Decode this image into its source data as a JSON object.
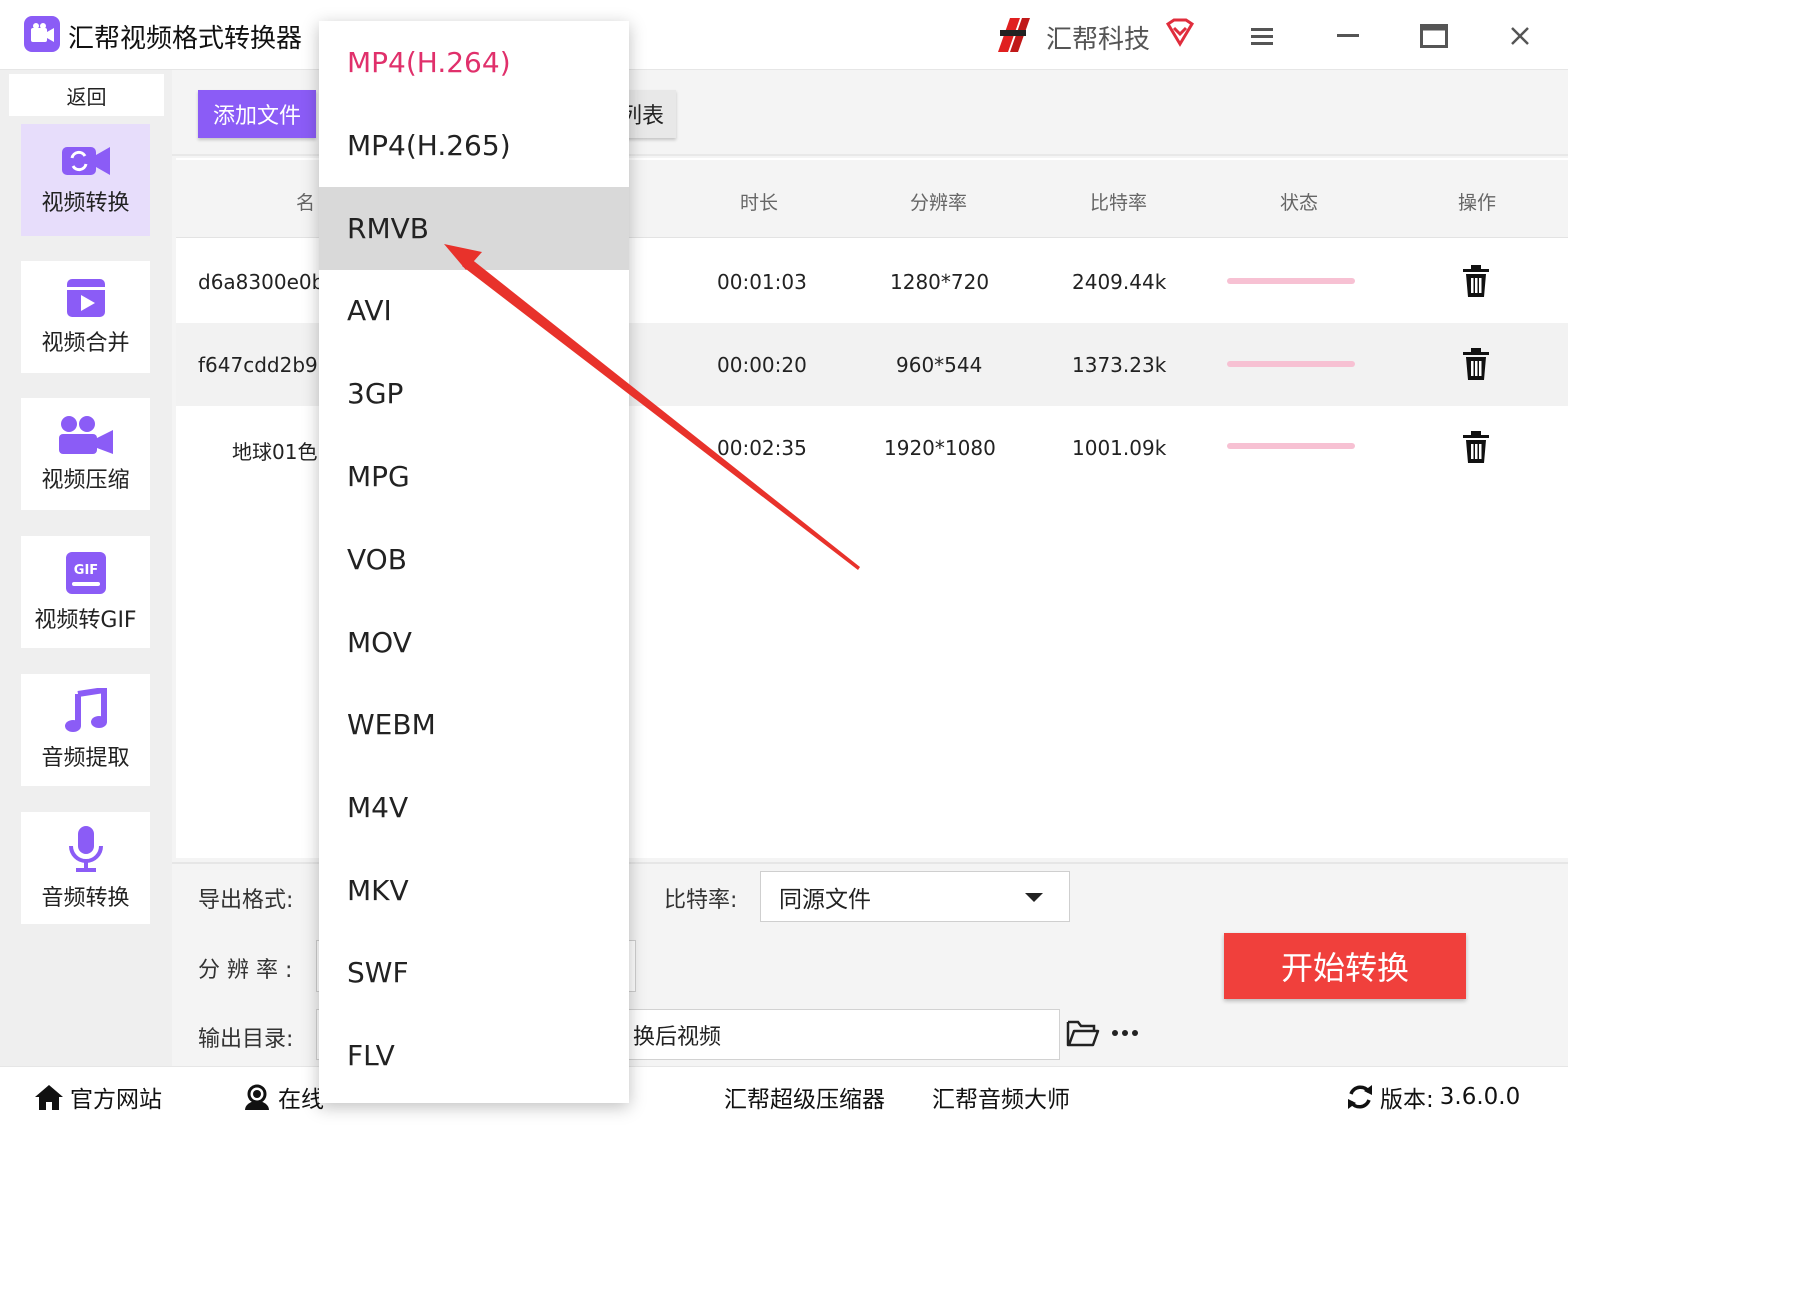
{
  "app": {
    "title": "汇帮视频格式转换器",
    "brand": "汇帮科技"
  },
  "colors": {
    "accent": "#8b5cf6",
    "start_button": "#f0403c",
    "selected_format": "#e0306b",
    "annotation_arrow": "#e8322b"
  },
  "sidebar": {
    "back_label": "返回",
    "items": [
      {
        "label": "视频转换",
        "icon": "video-convert-icon",
        "active": true
      },
      {
        "label": "视频合并",
        "icon": "video-merge-icon"
      },
      {
        "label": "视频压缩",
        "icon": "video-compress-icon"
      },
      {
        "label": "视频转GIF",
        "icon": "gif-icon"
      },
      {
        "label": "音频提取",
        "icon": "music-note-icon"
      },
      {
        "label": "音频转换",
        "icon": "microphone-icon"
      }
    ]
  },
  "toolbar": {
    "add_file_label": "添加文件",
    "clear_list_label_visible": "列表"
  },
  "table": {
    "headers": {
      "name": "名",
      "duration": "时长",
      "resolution": "分辨率",
      "bitrate": "比特率",
      "status": "状态",
      "action": "操作"
    },
    "rows": [
      {
        "name": "d6a8300e0b",
        "duration": "00:01:03",
        "resolution": "1280*720",
        "bitrate": "2409.44k"
      },
      {
        "name": "f647cdd2b9",
        "duration": "00:00:20",
        "resolution": "960*544",
        "bitrate": "1373.23k"
      },
      {
        "name": "地球01色",
        "duration": "00:02:35",
        "resolution": "1920*1080",
        "bitrate": "1001.09k"
      }
    ]
  },
  "settings": {
    "export_format_label": "导出格式:",
    "resolution_label": "分 辨 率 :",
    "output_dir_label": "输出目录:",
    "output_dir_value": "换后视频",
    "bitrate_label": "比特率:",
    "bitrate_value": "同源文件",
    "start_label": "开始转换"
  },
  "dropdown": {
    "selected": "MP4(H.264)",
    "hovered": "RMVB",
    "options": [
      "MP4(H.264)",
      "MP4(H.265)",
      "RMVB",
      "AVI",
      "3GP",
      "MPG",
      "VOB",
      "MOV",
      "WEBM",
      "M4V",
      "MKV",
      "SWF",
      "FLV"
    ]
  },
  "footer": {
    "website": "官方网站",
    "online_support_visible": "在线",
    "compressor": "汇帮超级压缩器",
    "audio_master": "汇帮音频大师",
    "version_label": "版本:",
    "version": "3.6.0.0"
  }
}
